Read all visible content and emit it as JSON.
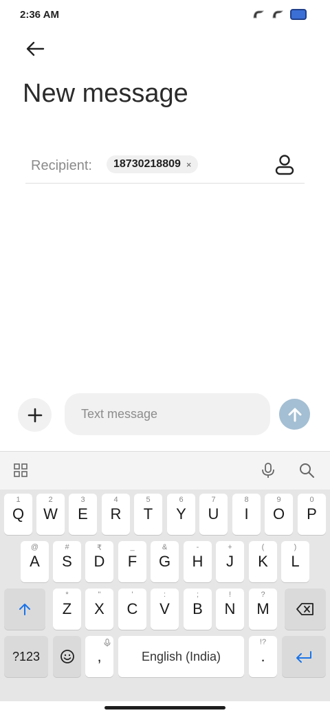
{
  "status_bar": {
    "time": "2:36 AM",
    "icons": [
      "signal-1-icon",
      "signal-2-icon",
      "battery-icon"
    ],
    "battery_color": "#3b6fd6"
  },
  "header": {
    "back_icon": "back-arrow-icon",
    "title": "New message"
  },
  "recipient": {
    "label": "Recipient:",
    "chips": [
      {
        "number": "18730218809",
        "remove_symbol": "×"
      }
    ],
    "contact_icon": "contact-person-icon"
  },
  "compose": {
    "add_icon": "plus-icon",
    "placeholder": "Text message",
    "send_icon": "send-arrow-icon",
    "send_color": "#a4bfd3"
  },
  "keyboard": {
    "toolbar": {
      "left_icon": "apps-grid-icon",
      "mic_icon": "microphone-icon",
      "search_icon": "search-icon"
    },
    "row1": [
      {
        "main": "Q",
        "hint": "1"
      },
      {
        "main": "W",
        "hint": "2"
      },
      {
        "main": "E",
        "hint": "3"
      },
      {
        "main": "R",
        "hint": "4"
      },
      {
        "main": "T",
        "hint": "5"
      },
      {
        "main": "Y",
        "hint": "6"
      },
      {
        "main": "U",
        "hint": "7"
      },
      {
        "main": "I",
        "hint": "8"
      },
      {
        "main": "O",
        "hint": "9"
      },
      {
        "main": "P",
        "hint": "0"
      }
    ],
    "row2": [
      {
        "main": "A",
        "hint": "@"
      },
      {
        "main": "S",
        "hint": "#"
      },
      {
        "main": "D",
        "hint": "₹"
      },
      {
        "main": "F",
        "hint": "_"
      },
      {
        "main": "G",
        "hint": "&"
      },
      {
        "main": "H",
        "hint": "-"
      },
      {
        "main": "J",
        "hint": "+"
      },
      {
        "main": "K",
        "hint": "("
      },
      {
        "main": "L",
        "hint": ")"
      }
    ],
    "row3": [
      {
        "main": "Z",
        "hint": "*"
      },
      {
        "main": "X",
        "hint": "\""
      },
      {
        "main": "C",
        "hint": "'"
      },
      {
        "main": "V",
        "hint": ":"
      },
      {
        "main": "B",
        "hint": ";"
      },
      {
        "main": "N",
        "hint": "!"
      },
      {
        "main": "M",
        "hint": "?"
      }
    ],
    "shift_icon": "shift-arrow-icon",
    "backspace_icon": "backspace-icon",
    "row4": {
      "symbols_label": "?123",
      "emoji_icon": "emoji-icon",
      "comma": ",",
      "space_label": "English (India)",
      "period": ".",
      "period_hint": "!?",
      "enter_icon": "enter-icon",
      "accent": "#1a73e8"
    }
  }
}
